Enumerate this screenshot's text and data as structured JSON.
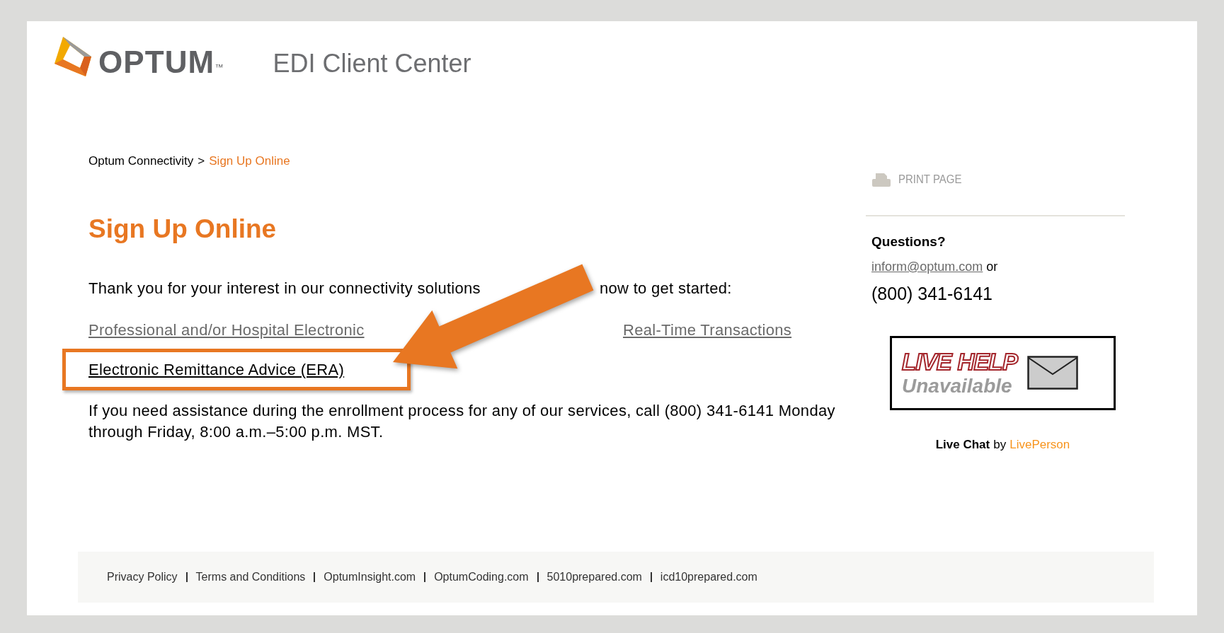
{
  "header": {
    "logo_text": "OPTUM",
    "trademark": "™",
    "title": "EDI Client Center"
  },
  "breadcrumb": [
    {
      "label": "Optum Connectivity",
      "current": false
    },
    {
      "label": "Sign Up Online",
      "current": true
    }
  ],
  "breadcrumb_separator": ">",
  "heading": "Sign Up Online",
  "intro": [
    "Thank you for your interest in our connectivity solutions",
    "now to get started:"
  ],
  "links": [
    {
      "parts": [
        "Professional and/or Hospital Electronic",
        "Real-Time Transactions"
      ],
      "visited": true,
      "highlighted": false
    },
    {
      "parts": [
        "Electronic Remittance Advice (ERA)"
      ],
      "visited": false,
      "highlighted": true
    }
  ],
  "assistance": "If you need assistance during the enrollment process for any of our services, call (800) 341-6141 Monday through Friday, 8:00 a.m.–5:00 p.m. MST.",
  "sidebar": {
    "print_label": "PRINT PAGE",
    "questions": "Questions?",
    "email": "inform@optum.com",
    "or": "or",
    "phone": "(800) 341-6141",
    "live_help": {
      "title": "LIVE HELP",
      "status": "Unavailable"
    },
    "credit": {
      "text": "Live Chat",
      "by": "by",
      "provider": "LivePerson"
    }
  },
  "footer": [
    "Privacy Policy",
    "Terms and Conditions",
    "OptumInsight.com",
    "OptumCoding.com",
    "5010prepared.com",
    "icd10prepared.com"
  ]
}
